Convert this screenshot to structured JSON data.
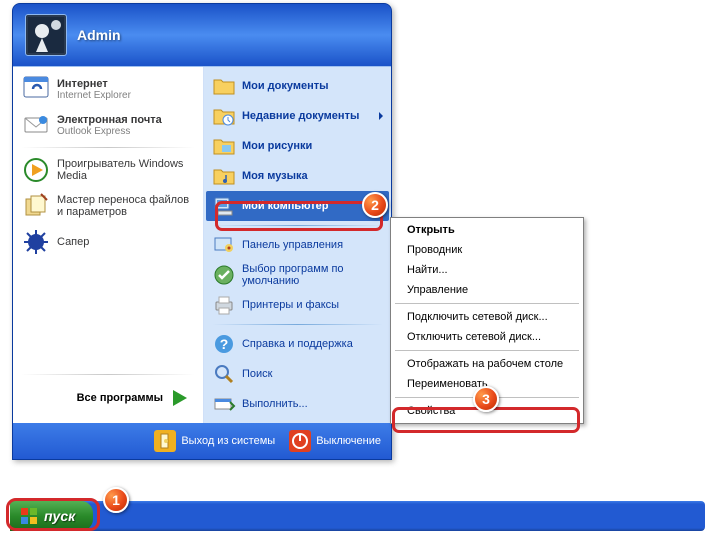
{
  "user": {
    "name": "Admin"
  },
  "left": {
    "internet": {
      "title": "Интернет",
      "sub": "Internet Explorer"
    },
    "email": {
      "title": "Электронная почта",
      "sub": "Outlook Express"
    },
    "wmp": "Проигрыватель Windows Media",
    "wizard": "Мастер переноса файлов и параметров",
    "saper": "Сапер",
    "all": "Все программы"
  },
  "right": {
    "mydocs": "Мои документы",
    "recent": "Недавние документы",
    "mypics": "Мои рисунки",
    "mymusic": "Моя музыка",
    "mycomp": "Мой компьютер",
    "cpanel": "Панель управления",
    "defaults": "Выбор программ по умолчанию",
    "printers": "Принтеры и факсы",
    "help": "Справка и поддержка",
    "search": "Поиск",
    "run": "Выполнить..."
  },
  "footer": {
    "logoff": "Выход из системы",
    "shutdown": "Выключение"
  },
  "context": {
    "open": "Открыть",
    "explore": "Проводник",
    "find": "Найти...",
    "manage": "Управление",
    "map": "Подключить сетевой диск...",
    "unmap": "Отключить сетевой диск...",
    "desktop": "Отображать на рабочем столе",
    "rename": "Переименовать",
    "props": "Свойства"
  },
  "start": "пуск",
  "badges": {
    "b1": "1",
    "b2": "2",
    "b3": "3"
  }
}
